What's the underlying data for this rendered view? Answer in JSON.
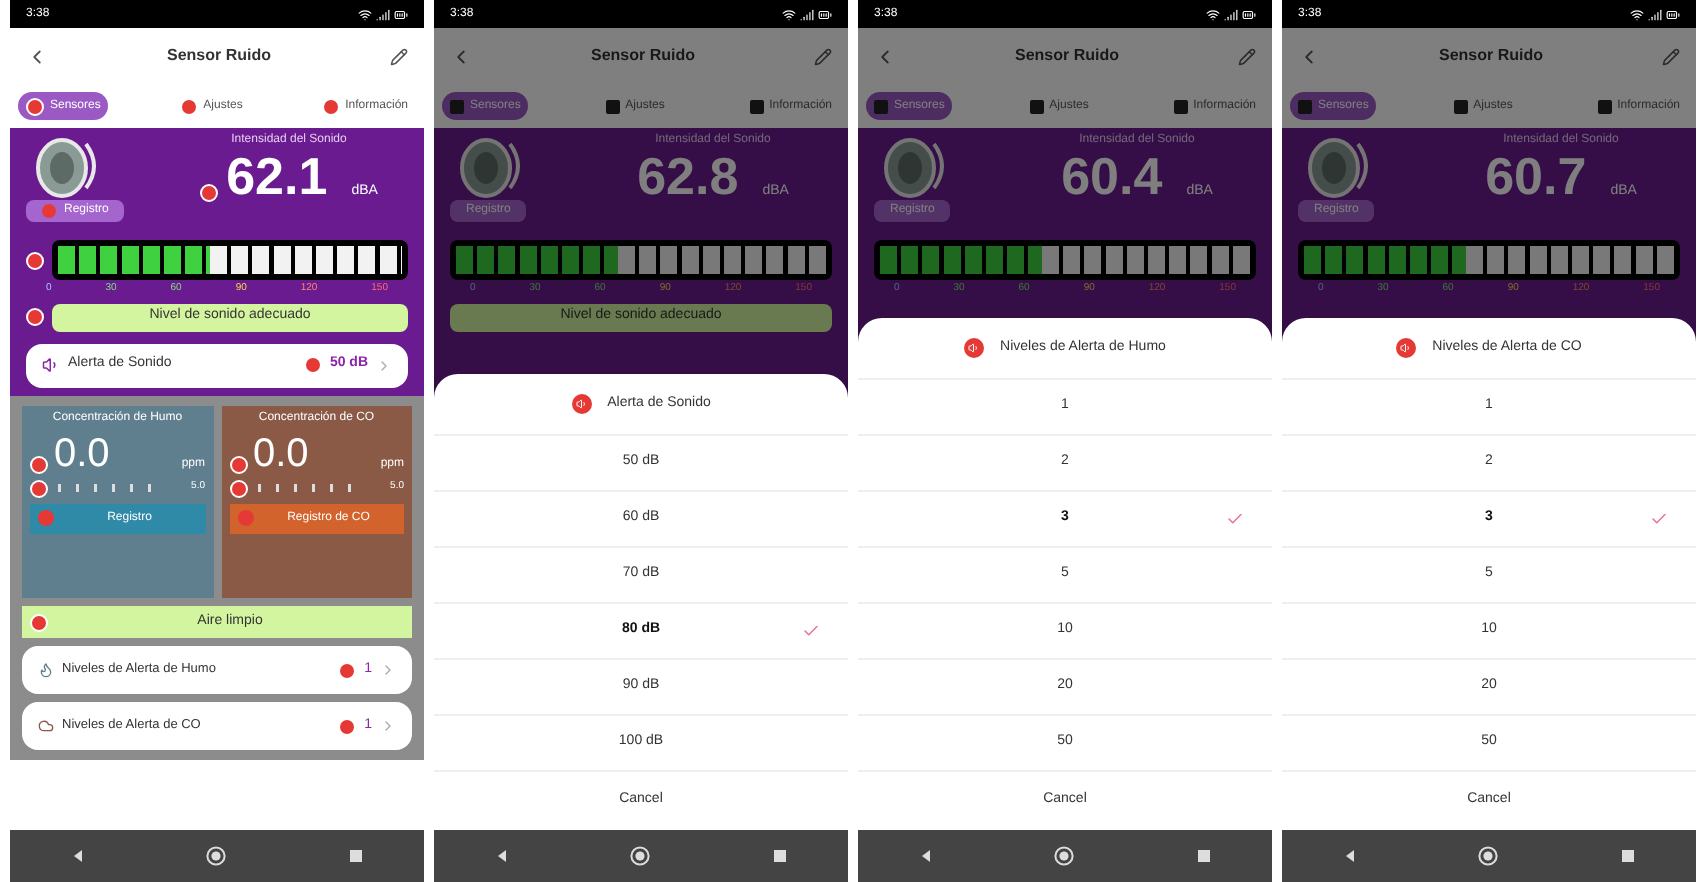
{
  "main": {
    "status_time": "3:38",
    "title": "Sensor Ruido",
    "tabs": [
      {
        "label": "Sensores",
        "selected": true
      },
      {
        "label": "Ajustes",
        "selected": false
      },
      {
        "label": "Información",
        "selected": false
      }
    ],
    "sound": {
      "label": "Intensidad del Sonido",
      "value": "62.1",
      "unit": "dBA",
      "log_button": "Registro",
      "level": 0.44,
      "scale": [
        "0",
        "30",
        "60",
        "90",
        "120",
        "150"
      ],
      "status": "Nivel de sonido adecuado",
      "alert": {
        "label": "Alerta de Sonido",
        "value": "50 dB"
      }
    },
    "gas_cards": [
      {
        "kind": "smoke",
        "title": "Concentración de Humo",
        "value": "0.0",
        "unit": "ppm",
        "scale_end": "5.0",
        "button": "Registro"
      },
      {
        "kind": "co",
        "title": "Concentración de CO",
        "value": "0.0",
        "unit": "ppm",
        "scale_end": "5.0",
        "button": "Registro de CO"
      }
    ],
    "air_status": "Aire limpio",
    "alert_levels": [
      {
        "kind": "smoke",
        "label": "Niveles de Alerta de Humo",
        "value": "1"
      },
      {
        "kind": "co",
        "label": "Niveles de Alerta de CO",
        "value": "1"
      }
    ]
  },
  "dialogs": [
    {
      "status_time": "3:38",
      "title": "Sensor Ruido",
      "tabs": [
        {
          "label": "Sensores",
          "selected": true
        },
        {
          "label": "Ajustes",
          "selected": false
        },
        {
          "label": "Información",
          "selected": false
        }
      ],
      "sound": {
        "label": "Intensidad del Sonido",
        "value": "62.8",
        "unit": "dBA",
        "log_button": "Registro",
        "level": 0.44,
        "scale": [
          "0",
          "30",
          "60",
          "90",
          "120",
          "150"
        ],
        "status": "Nivel de sonido adecuado"
      },
      "sheet": {
        "title": "Alerta de Sonido",
        "options": [
          {
            "label": "50 dB",
            "selected": false
          },
          {
            "label": "60 dB",
            "selected": false
          },
          {
            "label": "70 dB",
            "selected": false
          },
          {
            "label": "80 dB",
            "selected": true
          },
          {
            "label": "90 dB",
            "selected": false
          },
          {
            "label": "100 dB",
            "selected": false
          }
        ],
        "cancel": "Cancel"
      }
    },
    {
      "status_time": "3:38",
      "title": "Sensor Ruido",
      "tabs": [
        {
          "label": "Sensores",
          "selected": true
        },
        {
          "label": "Ajustes",
          "selected": false
        },
        {
          "label": "Información",
          "selected": false
        }
      ],
      "sound": {
        "label": "Intensidad del Sonido",
        "value": "60.4",
        "unit": "dBA",
        "log_button": "Registro",
        "level": 0.44,
        "scale": [
          "0",
          "30",
          "60",
          "90",
          "120",
          "150"
        ]
      },
      "sheet": {
        "title": "Niveles de Alerta de Humo",
        "options": [
          {
            "label": "1",
            "selected": false
          },
          {
            "label": "2",
            "selected": false
          },
          {
            "label": "3",
            "selected": true
          },
          {
            "label": "5",
            "selected": false
          },
          {
            "label": "10",
            "selected": false
          },
          {
            "label": "20",
            "selected": false
          },
          {
            "label": "50",
            "selected": false
          }
        ],
        "cancel": "Cancel"
      }
    },
    {
      "status_time": "3:38",
      "title": "Sensor Ruido",
      "tabs": [
        {
          "label": "Sensores",
          "selected": true
        },
        {
          "label": "Ajustes",
          "selected": false
        },
        {
          "label": "Información",
          "selected": false
        }
      ],
      "sound": {
        "label": "Intensidad del Sonido",
        "value": "60.7",
        "unit": "dBA",
        "log_button": "Registro",
        "level": 0.44,
        "scale": [
          "0",
          "30",
          "60",
          "90",
          "120",
          "150"
        ]
      },
      "sheet": {
        "title": "Niveles de Alerta de CO",
        "options": [
          {
            "label": "1",
            "selected": false
          },
          {
            "label": "2",
            "selected": false
          },
          {
            "label": "3",
            "selected": true
          },
          {
            "label": "5",
            "selected": false
          },
          {
            "label": "10",
            "selected": false
          },
          {
            "label": "20",
            "selected": false
          },
          {
            "label": "50",
            "selected": false
          }
        ],
        "cancel": "Cancel"
      }
    }
  ]
}
